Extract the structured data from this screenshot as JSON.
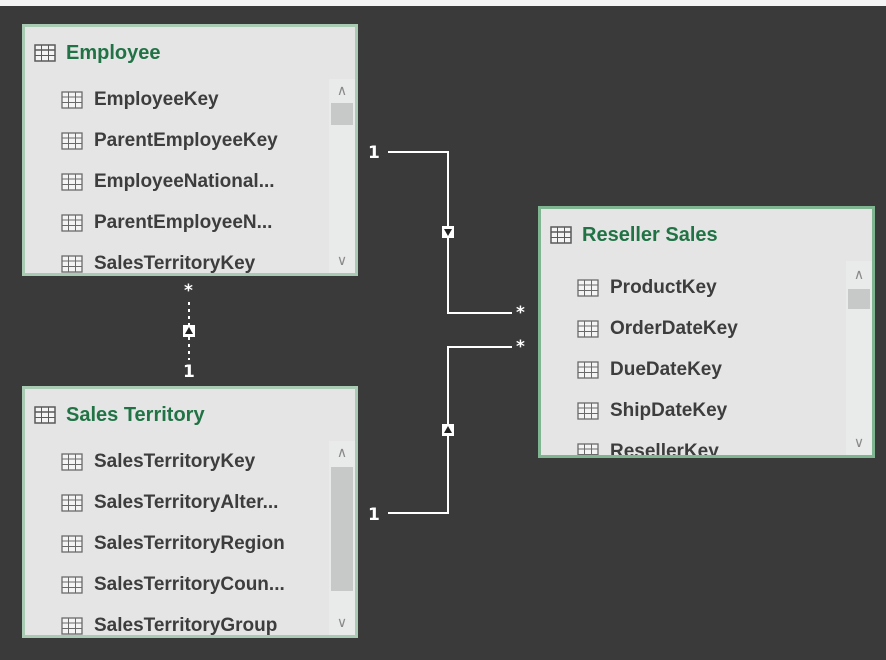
{
  "tables": {
    "employee": {
      "title": "Employee",
      "fields": [
        "EmployeeKey",
        "ParentEmployeeKey",
        "EmployeeNational...",
        "ParentEmployeeN...",
        "SalesTerritoryKey"
      ]
    },
    "sales_territory": {
      "title": "Sales Territory",
      "fields": [
        "SalesTerritoryKey",
        "SalesTerritoryAlter...",
        "SalesTerritoryRegion",
        "SalesTerritoryCoun...",
        "SalesTerritoryGroup"
      ]
    },
    "reseller_sales": {
      "title": "Reseller Sales",
      "fields": [
        "ProductKey",
        "OrderDateKey",
        "DueDateKey",
        "ShipDateKey",
        "ResellerKey"
      ]
    }
  },
  "relationships": {
    "employee_to_reseller": {
      "from_cardinality": "1",
      "to_cardinality": "*",
      "direction": "down"
    },
    "employee_to_territory": {
      "from_cardinality": "*",
      "to_cardinality": "1",
      "direction": "up"
    },
    "territory_to_reseller": {
      "from_cardinality": "1",
      "to_cardinality": "*",
      "direction": "up"
    }
  },
  "colors": {
    "background": "#3a3a3a",
    "card_background": "#e4e5e4",
    "card_border": "#a9cbb3",
    "title_green": "#217346",
    "connector": "#ffffff"
  },
  "icons": {
    "table": "table-grid-icon",
    "scroll_up": "chevron-up-icon",
    "scroll_down": "chevron-down-icon",
    "relationship_arrow": "filter-direction-arrow-icon"
  }
}
